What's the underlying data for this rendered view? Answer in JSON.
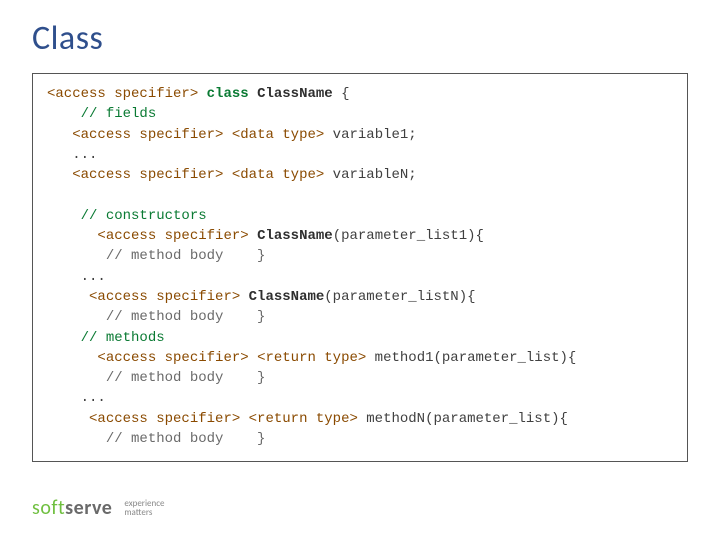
{
  "title": "Class",
  "code": {
    "l1_spec": "<access specifier>",
    "l1_kw": "class",
    "l1_name": "ClassName",
    "l1_open": " {",
    "l2": "// fields",
    "l3_spec": "<access specifier>",
    "l3_type": "<data type>",
    "l3_var": " variable1;",
    "l4": "...",
    "l5_spec": "<access specifier>",
    "l5_type": "<data type>",
    "l5_var": " variableN;",
    "l7": "// constructors",
    "l8_spec": "<access specifier>",
    "l8_name": "ClassName",
    "l8_rest": "(parameter_list1){",
    "l9": "// method body    }",
    "l10": "...",
    "l11_spec": "<access specifier>",
    "l11_name": "ClassName",
    "l11_rest": "(parameter_listN){",
    "l12": "// method body    }",
    "l13": "// methods",
    "l14_spec": "<access specifier>",
    "l14_ret": "<return type>",
    "l14_rest": " method1(parameter_list){",
    "l15": "// method body    }",
    "l16": "...",
    "l17_spec": "<access specifier>",
    "l17_ret": "<return type>",
    "l17_rest": " methodN(parameter_list){",
    "l18": "// method body    }"
  },
  "footer": {
    "logo_soft": "soft",
    "logo_serve": "serve",
    "tagline1": "experience",
    "tagline2": "matters"
  }
}
